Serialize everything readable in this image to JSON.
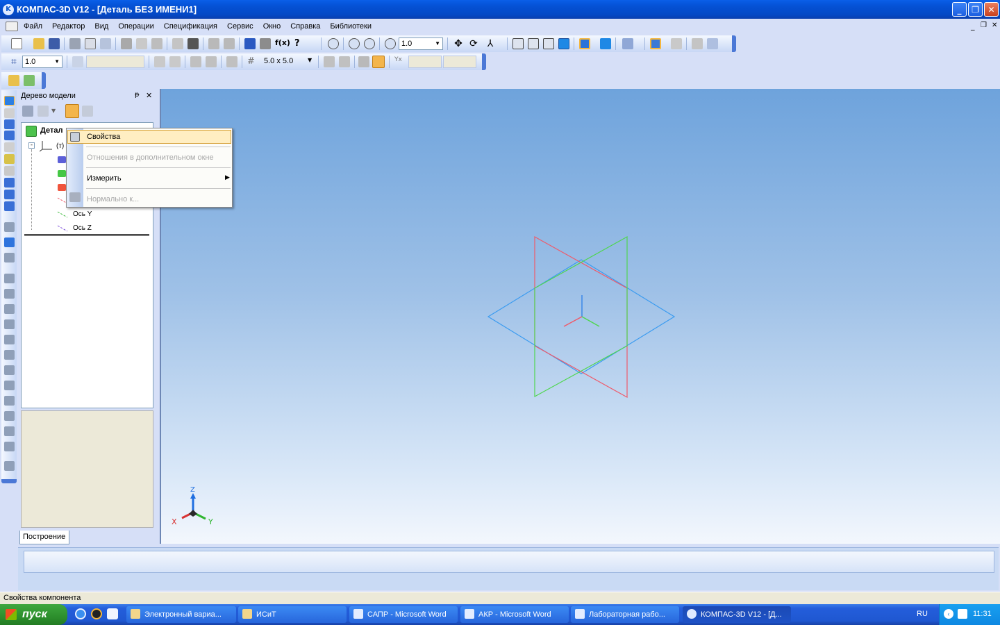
{
  "window": {
    "title": "КОМПАС-3D V12 - [Деталь БЕЗ ИМЕНИ1]",
    "buttons": [
      "_",
      "❐",
      "✕"
    ]
  },
  "menu": {
    "items": [
      "Файл",
      "Редактор",
      "Вид",
      "Операции",
      "Спецификация",
      "Сервис",
      "Окно",
      "Справка",
      "Библиотеки"
    ],
    "doc_controls": [
      "_",
      "❐",
      "✕"
    ]
  },
  "toolbar1": {
    "zoom_value": "1.0"
  },
  "toolbar2": {
    "step_value": "1.0",
    "grid_value": "5.0 x 5.0"
  },
  "tree": {
    "title": "Дерево модели",
    "pin": "ᵽ",
    "close": "✕",
    "root_label": "Детал",
    "origin_label": "(т)",
    "axis_y": "Ось Y",
    "axis_z": "Ось Z",
    "tab_label": "Построение"
  },
  "context_menu": {
    "items": [
      {
        "label": "Свойства",
        "enabled": true,
        "highlighted": true
      },
      {
        "label": "Отношения в дополнительном окне",
        "enabled": false
      },
      {
        "label": "Измерить",
        "enabled": true,
        "submenu": true
      },
      {
        "label": "Нормально к...",
        "enabled": false
      }
    ]
  },
  "viewport": {
    "axis_x": "X",
    "axis_y": "Y",
    "axis_z": "Z",
    "colors": {
      "plane_xy": "#3a9bf0",
      "plane_zx": "#ef5a6a",
      "plane_zy": "#4fd64f"
    }
  },
  "status": {
    "text": "Свойства компонента"
  },
  "taskbar": {
    "start_label": "пуск",
    "tasks": [
      {
        "label": "Электронный вариа...",
        "active": false
      },
      {
        "label": "ИСиТ",
        "active": false
      },
      {
        "label": "САПР - Microsoft Word",
        "active": false
      },
      {
        "label": "АКР - Microsoft Word",
        "active": false
      },
      {
        "label": "Лабораторная рабо...",
        "active": false
      },
      {
        "label": "КОМПАС-3D V12 - [Д...",
        "active": true
      }
    ],
    "lang": "RU",
    "clock": "11:31"
  }
}
